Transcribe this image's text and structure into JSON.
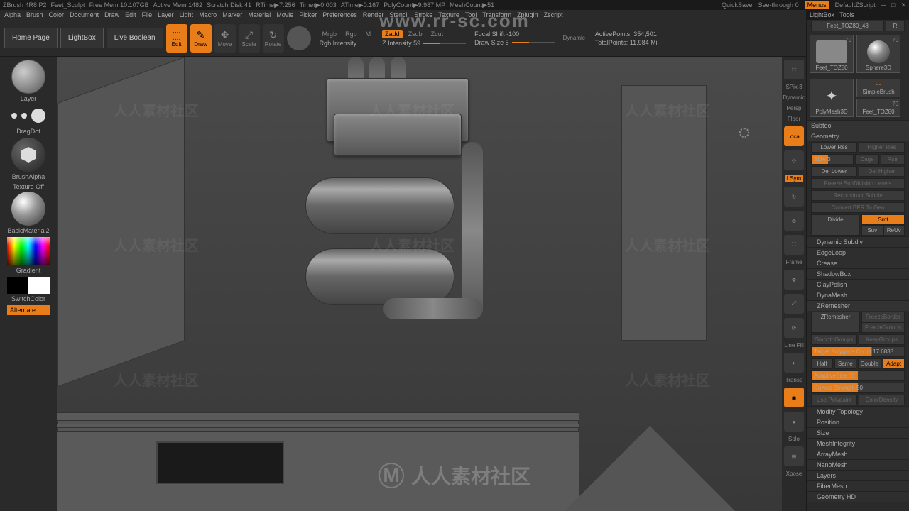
{
  "titlebar": {
    "app": "ZBrush 4R8 P2",
    "project": "Feet_Sculpt",
    "stats": [
      "Free Mem 10.107GB",
      "Active Mem 1482",
      "Scratch Disk 41",
      "RTime▶7.256",
      "Timer▶0.003",
      "ATime▶0.167",
      "PolyCount▶9.987 MP",
      "MeshCount▶51"
    ],
    "quicksave": "QuickSave",
    "seethrough": "See-through  0",
    "menus": "Menus",
    "script": "DefaultZScript"
  },
  "menubar": [
    "Alpha",
    "Brush",
    "Color",
    "Document",
    "Draw",
    "Edit",
    "File",
    "Layer",
    "Light",
    "Macro",
    "Marker",
    "Material",
    "Movie",
    "Picker",
    "Preferences",
    "Render",
    "Stencil",
    "Stroke",
    "Texture",
    "Tool",
    "Transform",
    "Zplugin",
    "Zscript"
  ],
  "toolbar": {
    "tabs": [
      "Home Page",
      "LightBox",
      "Live Boolean"
    ],
    "edit": "Edit",
    "draw": "Draw",
    "move": "Move",
    "scale": "Scale",
    "rotate": "Rotate",
    "modes": [
      "Mrgb",
      "Rgb",
      "M"
    ],
    "rgb_label": "Rgb Intensity",
    "zmodes": {
      "zadd": "Zadd",
      "zsub": "Zsub",
      "zcut": "Zcut"
    },
    "zint_label": "Z Intensity 59",
    "focal": "Focal Shift -100",
    "drawsize": "Draw Size 5",
    "dynamic": "Dynamic",
    "active": "ActivePoints: 354,501",
    "total": "TotalPoints: 11.984 Mil"
  },
  "left": {
    "layer": "Layer",
    "dragdot": "DragDot",
    "brushalpha": "BrushAlpha",
    "texture": "Texture Off",
    "material": "BasicMaterial2",
    "gradient": "Gradient",
    "switch": "SwitchColor",
    "alternate": "Alternate"
  },
  "vptools": {
    "spix": "SPix 3",
    "dynamic": "Dynamic",
    "persp": "Persp",
    "floor": "Floor",
    "local": "Local",
    "lsym": "LSym",
    "frame": "Frame",
    "linefill": "Line Fill",
    "transp": "Transp",
    "solo": "Solo",
    "xpose": "Xpose"
  },
  "right": {
    "lightbox": "LightBox | Tools",
    "current_tool": "Feet_TOZ80_48",
    "r": "R",
    "tools": [
      {
        "name": "Feet_TOZ80",
        "cnt": "70"
      },
      {
        "name": "Sphere3D",
        "cnt": "70"
      },
      {
        "name": "PolyMesh3D",
        "cnt": ""
      },
      {
        "name": "SimpleBrush",
        "cnt": ""
      },
      {
        "name": "Feet_TOZ80",
        "cnt": "70"
      }
    ],
    "sections": {
      "subtool": "Subtool",
      "geometry": "Geometry",
      "lowerres": "Lower Res",
      "higherres": "Higher Res",
      "sdiv": "SDiv 3",
      "cage": "Cage",
      "rstr": "Rstr",
      "dellower": "Del Lower",
      "delhigher": "Del Higher",
      "freeze": "Freeze SubDivision Levels",
      "reconstruct": "Reconstruct Subdiv",
      "convertbpr": "Convert BPR To Geo",
      "divide": "Divide",
      "smt": "Smt",
      "suv": "Suv",
      "reuv": "ReUv",
      "dynsubdiv": "Dynamic Subdiv",
      "edgeloop": "EdgeLoop",
      "crease": "Crease",
      "shadowbox": "ShadowBox",
      "claypolish": "ClayPolish",
      "dynamesh": "DynaMesh",
      "zremesher": "ZRemesher",
      "zremesher2": "ZRemesher",
      "freezeborder": "FreezeBorder",
      "freezegroups": "FreezeGroups",
      "keepgroups": "KeepGroups",
      "smoothgroups": "SmoothGroups",
      "target": "Target Polygons Count 17.6838",
      "half": "Half",
      "same": "Same",
      "double": "Double",
      "adapt": "Adapt",
      "adaptive": "AdaptiveSize 50",
      "curves": "Curves Strength 50",
      "polypaint": "Use Polypaint",
      "colordensity": "ColorDensity",
      "modifytopo": "Modify Topology",
      "position": "Position",
      "size": "Size",
      "meshint": "MeshIntegrity",
      "arraymesh": "ArrayMesh",
      "nanomesh": "NanoMesh",
      "layers": "Layers",
      "fibermesh": "FiberMesh",
      "geohd": "Geometry HD"
    }
  },
  "watermark": {
    "url": "www.rr-sc.com",
    "center": "人人素材社区"
  }
}
